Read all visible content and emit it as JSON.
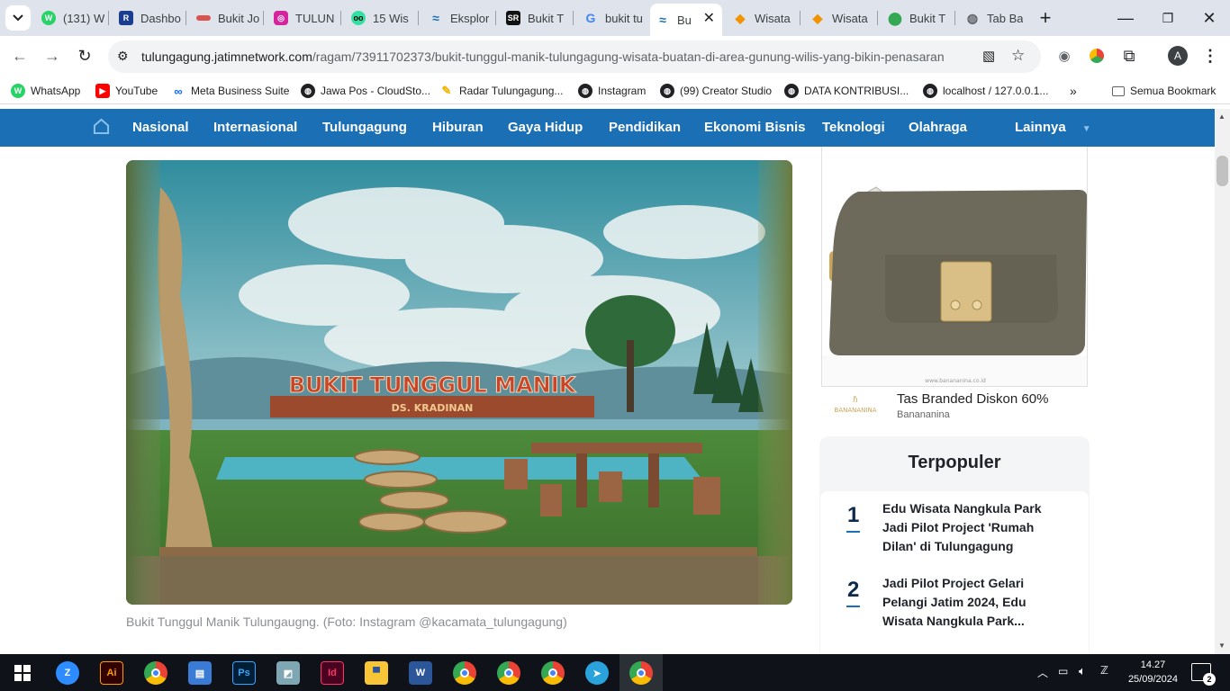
{
  "browser": {
    "tabs": [
      {
        "label": "(131) W",
        "icon": "whatsapp-icon",
        "color": "#25d366"
      },
      {
        "label": "Dashbo",
        "icon": "dashboard-icon",
        "color": "#1a3d8f"
      },
      {
        "label": "Bukit Jo",
        "icon": "site-icon",
        "color": "#d9534f"
      },
      {
        "label": "TULUN",
        "icon": "instagram-icon",
        "color": "#d6249f"
      },
      {
        "label": "15 Wis",
        "icon": "tripadvisor-icon",
        "color": "#34e0a1"
      },
      {
        "label": "Eksplor",
        "icon": "jatimnetwork-icon",
        "color": "#1b6fb4"
      },
      {
        "label": "Bukit T",
        "icon": "sr-icon",
        "color": "#111111"
      },
      {
        "label": "bukit tu",
        "icon": "google-icon",
        "color": "#4285f4"
      },
      {
        "label": "Bu",
        "icon": "jatimnetwork-icon",
        "color": "#1b6fb4"
      },
      {
        "label": "Wisata",
        "icon": "kompas-icon",
        "color": "#f29400"
      },
      {
        "label": "Wisata",
        "icon": "kompas-icon",
        "color": "#f29400"
      },
      {
        "label": "Bukit T",
        "icon": "maps-icon",
        "color": "#34a853"
      },
      {
        "label": "Tab Ba",
        "icon": "globe-icon",
        "color": "#5f6368"
      }
    ],
    "url_host": "tulungagung.jatimnetwork.com",
    "url_path": "/ragam/73911702373/bukit-tunggul-manik-tulungagung-wisata-buatan-di-area-gunung-wilis-yang-bikin-penasaran",
    "profile_initial": "A",
    "bookmarks": [
      {
        "label": "WhatsApp",
        "color": "#25d366"
      },
      {
        "label": "YouTube",
        "color": "#ff0000"
      },
      {
        "label": "Meta Business Suite",
        "color": "#0866ff"
      },
      {
        "label": "Jawa Pos - CloudSto...",
        "color": "#202124"
      },
      {
        "label": "Radar Tulungagung...",
        "color": "#f4b400"
      },
      {
        "label": "Instagram",
        "color": "#202124"
      },
      {
        "label": "(99) Creator Studio",
        "color": "#202124"
      },
      {
        "label": "DATA KONTRIBUSI...",
        "color": "#202124"
      },
      {
        "label": "localhost / 127.0.0.1...",
        "color": "#202124"
      }
    ],
    "all_bookmarks": "Semua Bookmark"
  },
  "site": {
    "nav": [
      "Nasional",
      "Internasional",
      "Tulungagung",
      "Hiburan",
      "Gaya Hidup",
      "Pendidikan",
      "Ekonomi Bisnis",
      "Teknologi",
      "Olahraga"
    ],
    "nav_more": "Lainnya",
    "hero_sign": "BUKIT TUNGGUL MANIK",
    "hero_subsign": "DS. KRADINAN",
    "caption": "Bukit Tunggul Manik Tulungaugng. (Foto: Instagram @kacamata_tulungagung)",
    "ad": {
      "title": "Tas Branded Diskon 60%",
      "brand": "Banananina",
      "logo_text": "BANANANINA",
      "watermark": "www.banananina.co.id"
    },
    "popular": {
      "title": "Terpopuler",
      "items": [
        {
          "rank": "1",
          "title": "Edu Wisata Nangkula Park Jadi Pilot Project 'Rumah Dilan' di Tulungagung"
        },
        {
          "rank": "2",
          "title": "Jadi Pilot Project Gelari Pelangi Jatim 2024, Edu Wisata Nangkula Park..."
        }
      ]
    }
  },
  "taskbar": {
    "time": "14.27",
    "date": "25/09/2024",
    "notifications": "2",
    "apps": [
      {
        "icon": "zoom-icon",
        "label": "Z",
        "color": "#2d8cff"
      },
      {
        "icon": "illustrator-icon",
        "label": "Ai",
        "color": "#330000"
      },
      {
        "icon": "chrome-icon",
        "label": "",
        "color": "#4285f4"
      },
      {
        "icon": "file-manager-icon",
        "label": "",
        "color": "#3a7bd5"
      },
      {
        "icon": "photoshop-icon",
        "label": "Ps",
        "color": "#001e36"
      },
      {
        "icon": "notes-icon",
        "label": "",
        "color": "#7fa7b3"
      },
      {
        "icon": "indesign-icon",
        "label": "Id",
        "color": "#49021f"
      },
      {
        "icon": "explorer-icon",
        "label": "",
        "color": "#f8c537"
      },
      {
        "icon": "word-icon",
        "label": "W",
        "color": "#2b579a"
      },
      {
        "icon": "chrome-profile-icon",
        "label": "",
        "color": "#34a853"
      },
      {
        "icon": "chrome-profile-icon",
        "label": "",
        "color": "#ea4335"
      },
      {
        "icon": "chrome-profile-icon",
        "label": "",
        "color": "#4285f4"
      },
      {
        "icon": "telegram-icon",
        "label": "",
        "color": "#2aa3dd"
      },
      {
        "icon": "chrome-active-icon",
        "label": "",
        "color": "#ea4335"
      }
    ]
  }
}
